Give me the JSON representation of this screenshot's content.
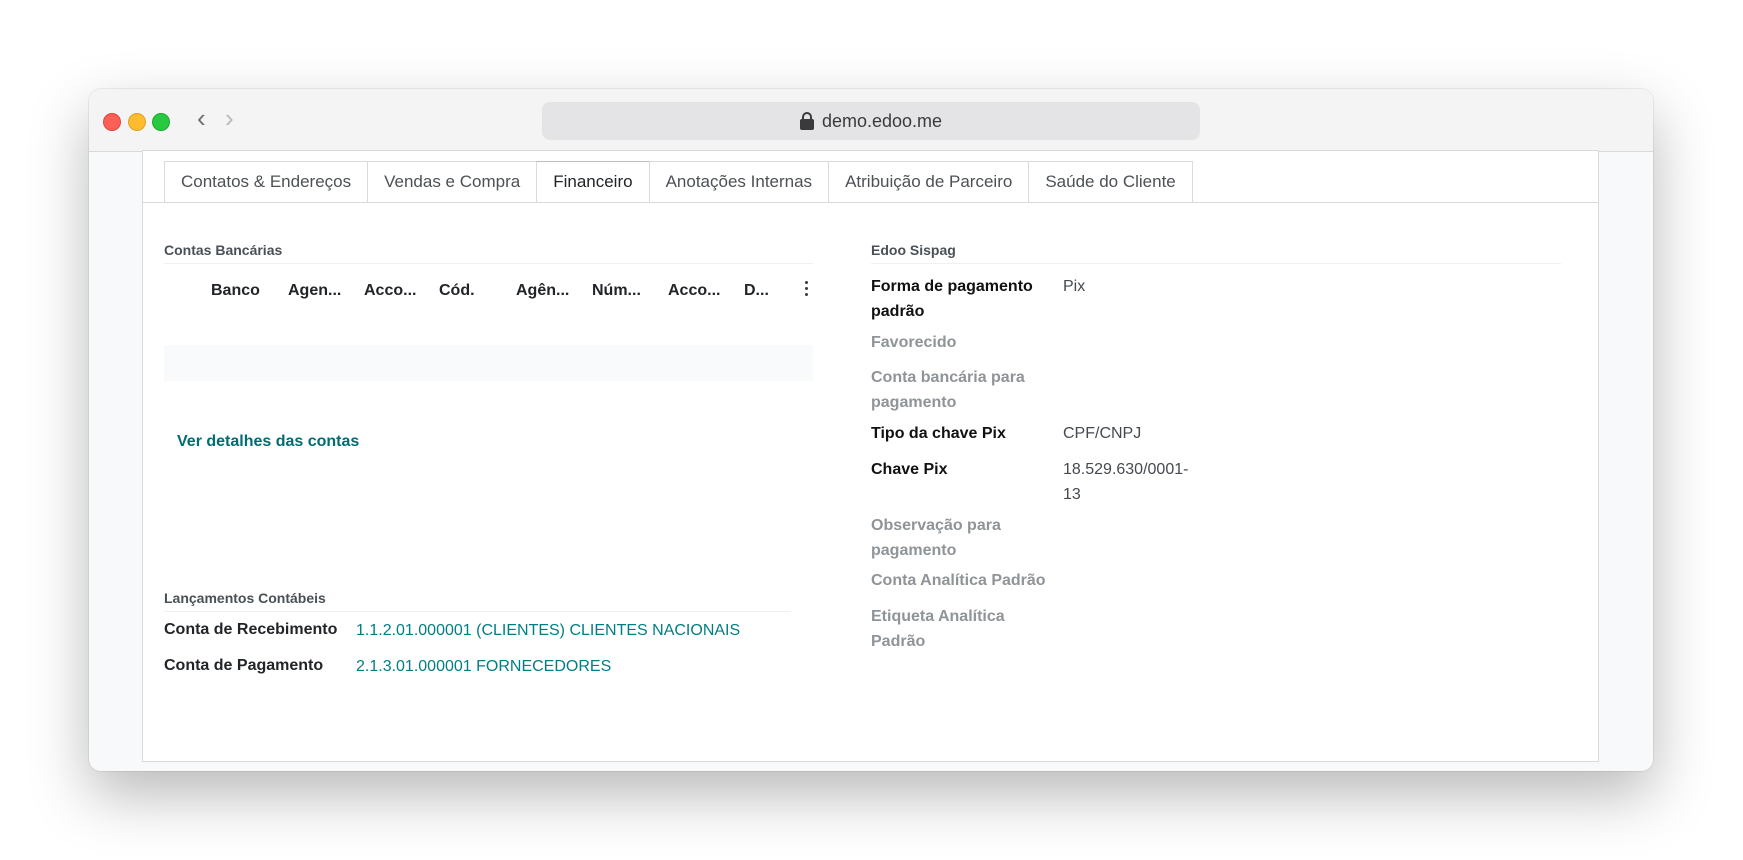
{
  "browser": {
    "url": "demo.edoo.me"
  },
  "tabs": [
    {
      "label": "Contatos & Endereços",
      "active": false
    },
    {
      "label": "Vendas e Compra",
      "active": false
    },
    {
      "label": "Financeiro",
      "active": true
    },
    {
      "label": "Anotações Internas",
      "active": false
    },
    {
      "label": "Atribuição de Parceiro",
      "active": false
    },
    {
      "label": "Saúde do Cliente",
      "active": false
    }
  ],
  "bank_accounts": {
    "title": "Contas Bancárias",
    "columns": [
      "Banco",
      "Agen...",
      "Acco...",
      "Cód.",
      "Agên...",
      "Núm...",
      "Acco...",
      "D..."
    ],
    "details_link": "Ver detalhes das contas"
  },
  "accounting": {
    "title": "Lançamentos Contábeis",
    "receivable_label": "Conta de Recebimento",
    "receivable_value": "1.1.2.01.000001 (CLIENTES) CLIENTES NACIONAIS",
    "payable_label": "Conta de Pagamento",
    "payable_value": "2.1.3.01.000001 FORNECEDORES"
  },
  "sispag": {
    "title": "Edoo Sispag",
    "fields": [
      {
        "label": "Forma de pagamento padrão",
        "value": "Pix",
        "required": true
      },
      {
        "label": "Favorecido",
        "value": "",
        "required": false
      },
      {
        "label": "Conta bancária para pagamento",
        "value": "",
        "required": false
      },
      {
        "label": "Tipo da chave Pix",
        "value": "CPF/CNPJ",
        "required": true
      },
      {
        "label": "Chave Pix",
        "value": "18.529.630/0001-13",
        "required": true
      },
      {
        "label": "Observação para pagamento",
        "value": "",
        "required": false
      },
      {
        "label": "Conta Analítica Padrão",
        "value": "",
        "required": false
      },
      {
        "label": "Etiqueta Analítica Padrão",
        "value": "",
        "required": false
      }
    ]
  },
  "colors": {
    "link": "#017e84",
    "muted_label": "#8f9498"
  }
}
